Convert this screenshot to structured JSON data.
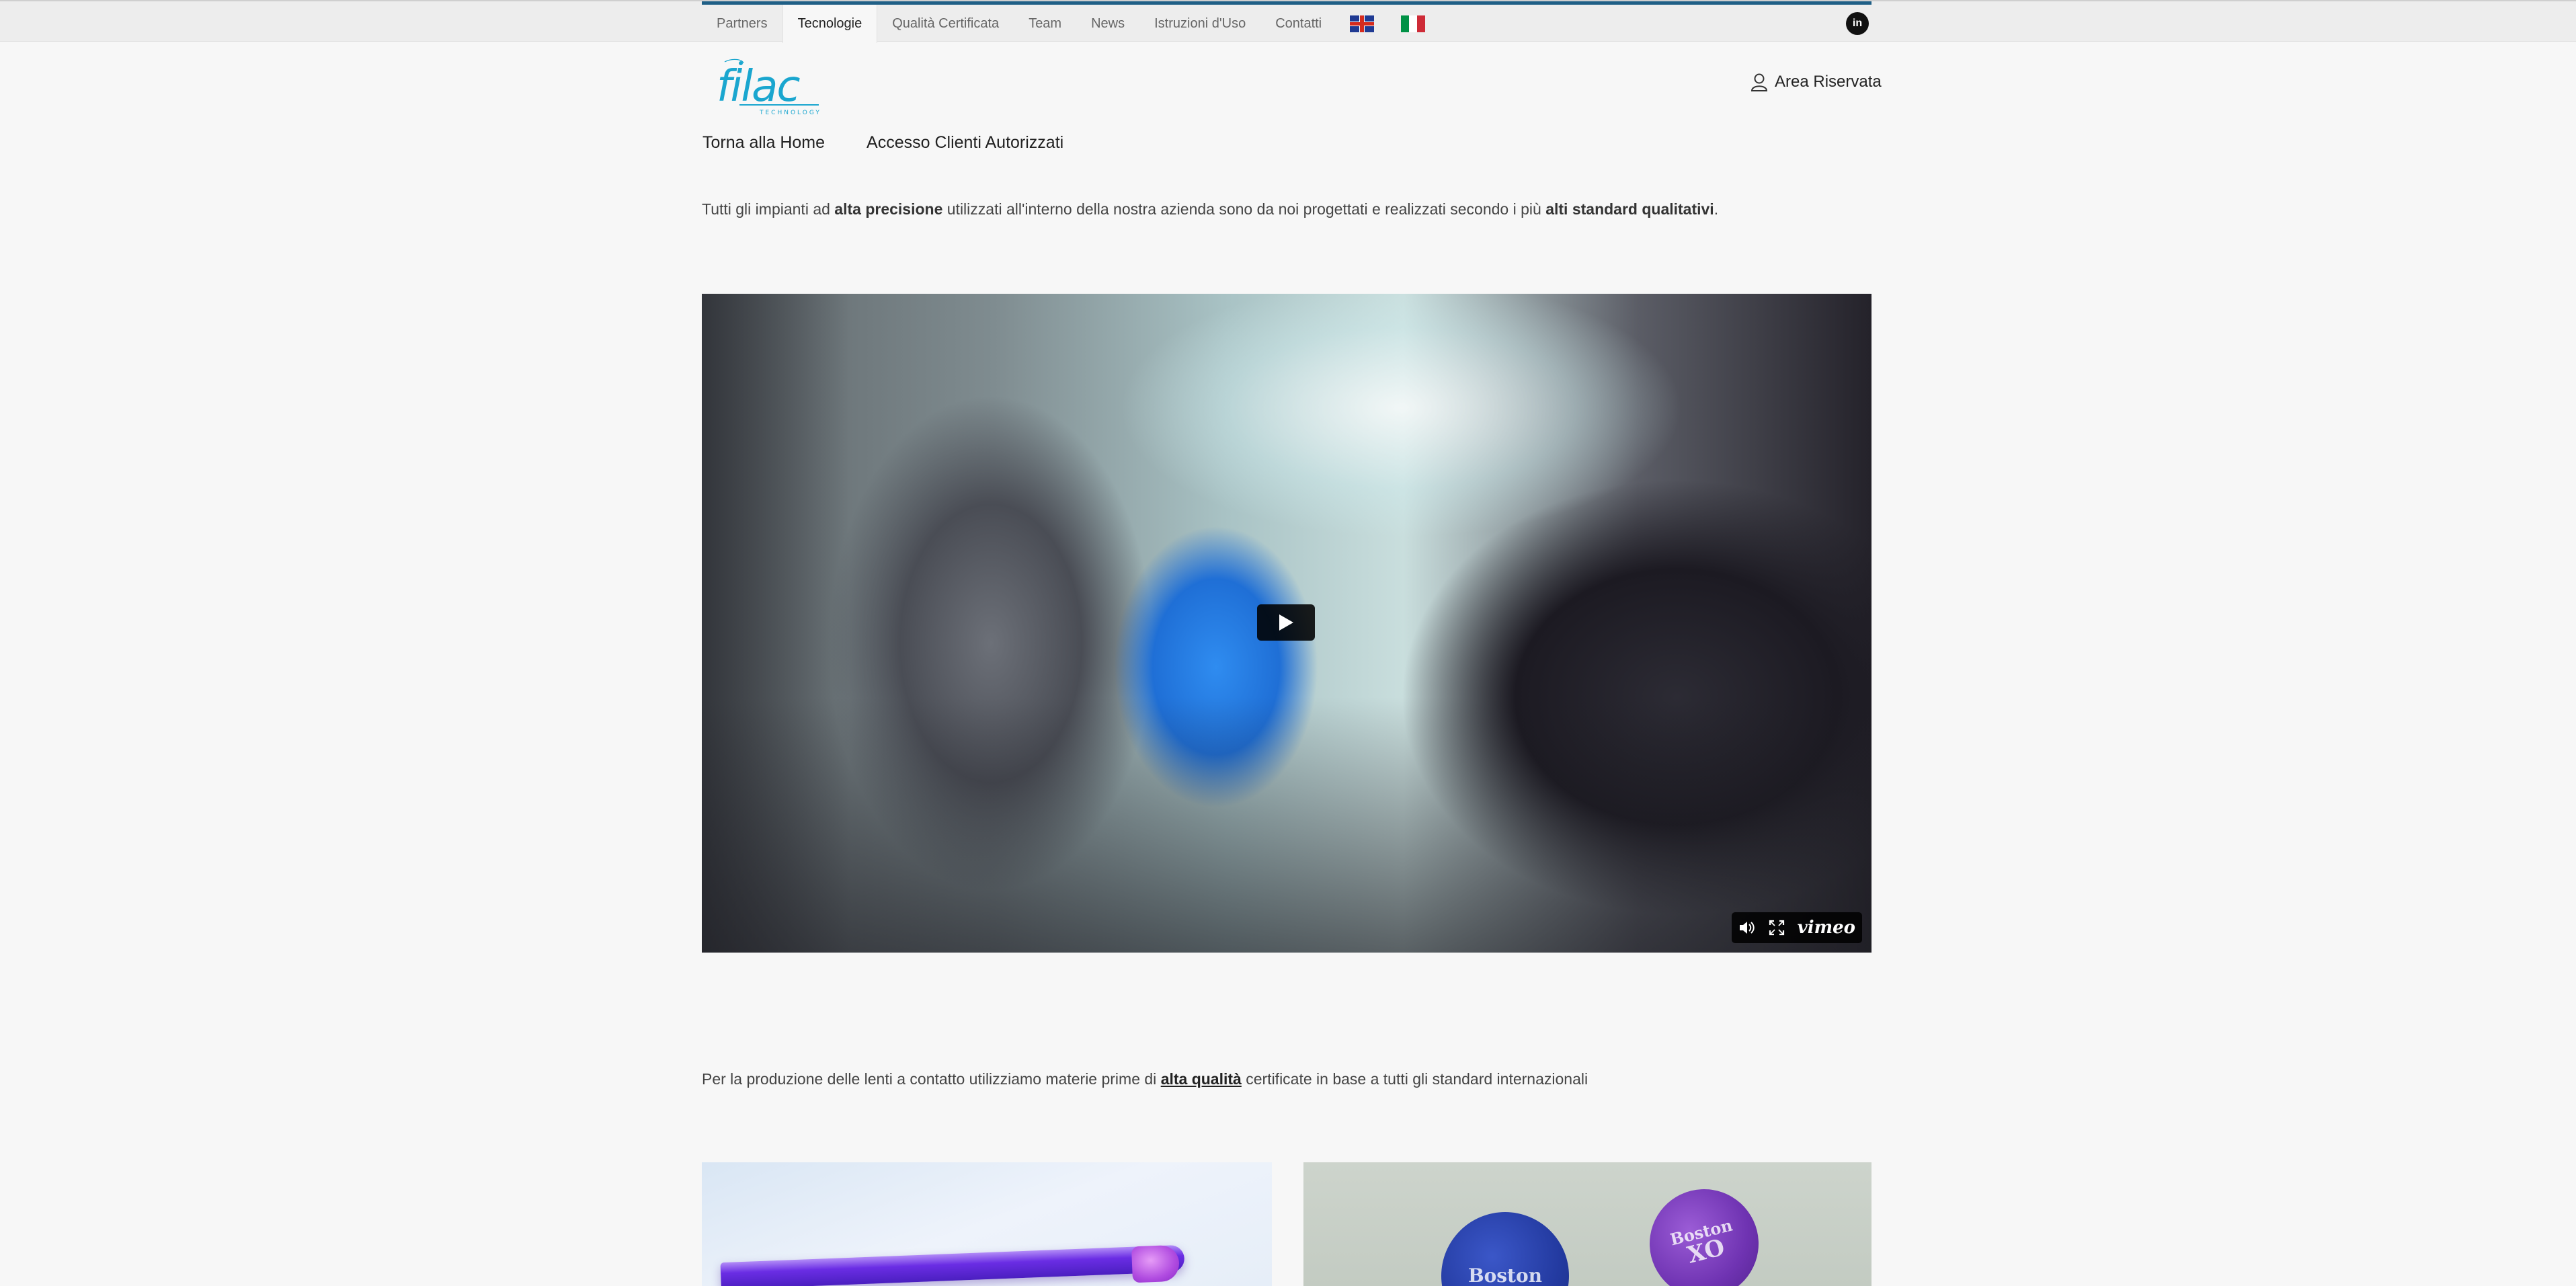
{
  "top_nav": {
    "items": [
      {
        "label": "Partners",
        "active": false
      },
      {
        "label": "Tecnologie",
        "active": true
      },
      {
        "label": "Qualità Certificata",
        "active": false
      },
      {
        "label": "Team",
        "active": false
      },
      {
        "label": "News",
        "active": false
      },
      {
        "label": "Istruzioni d'Uso",
        "active": false
      },
      {
        "label": "Contatti",
        "active": false
      }
    ],
    "languages": [
      {
        "name": "english-flag-icon"
      },
      {
        "name": "italian-flag-icon"
      }
    ],
    "social_icon": "linkedin-icon",
    "social_label": "in",
    "accent_color": "#1f5f86"
  },
  "header": {
    "logo_text": "filac",
    "logo_subtext": "TECHNOLOGY",
    "logo_color": "#1aa6cf",
    "area_label": "Area Riservata",
    "area_icon": "user-icon"
  },
  "sub_nav": {
    "items": [
      {
        "label": "Torna alla Home"
      },
      {
        "label": "Accesso Clienti Autorizzati"
      }
    ]
  },
  "intro": {
    "part1": "Tutti gli impianti ad ",
    "bold1": "alta precisione",
    "part2": " utilizzati all'interno della nostra azienda sono da noi progettati e realizzati secondo i più ",
    "bold2": "alti standard qualitativi",
    "part3": "."
  },
  "video": {
    "play_icon": "play-icon",
    "volume_icon": "volume-icon",
    "fullscreen_icon": "fullscreen-icon",
    "brand": "vimeo"
  },
  "materials": {
    "part1": "Per la produzione delle lenti a contatto utilizziamo materie prime di ",
    "link": "alta qualità",
    "part2": " certificate in base a tutti gli standard internazionali"
  },
  "gallery": {
    "right_disc_1": "Boston",
    "right_disc_2_line1": "Boston",
    "right_disc_2_line2": "XO"
  }
}
